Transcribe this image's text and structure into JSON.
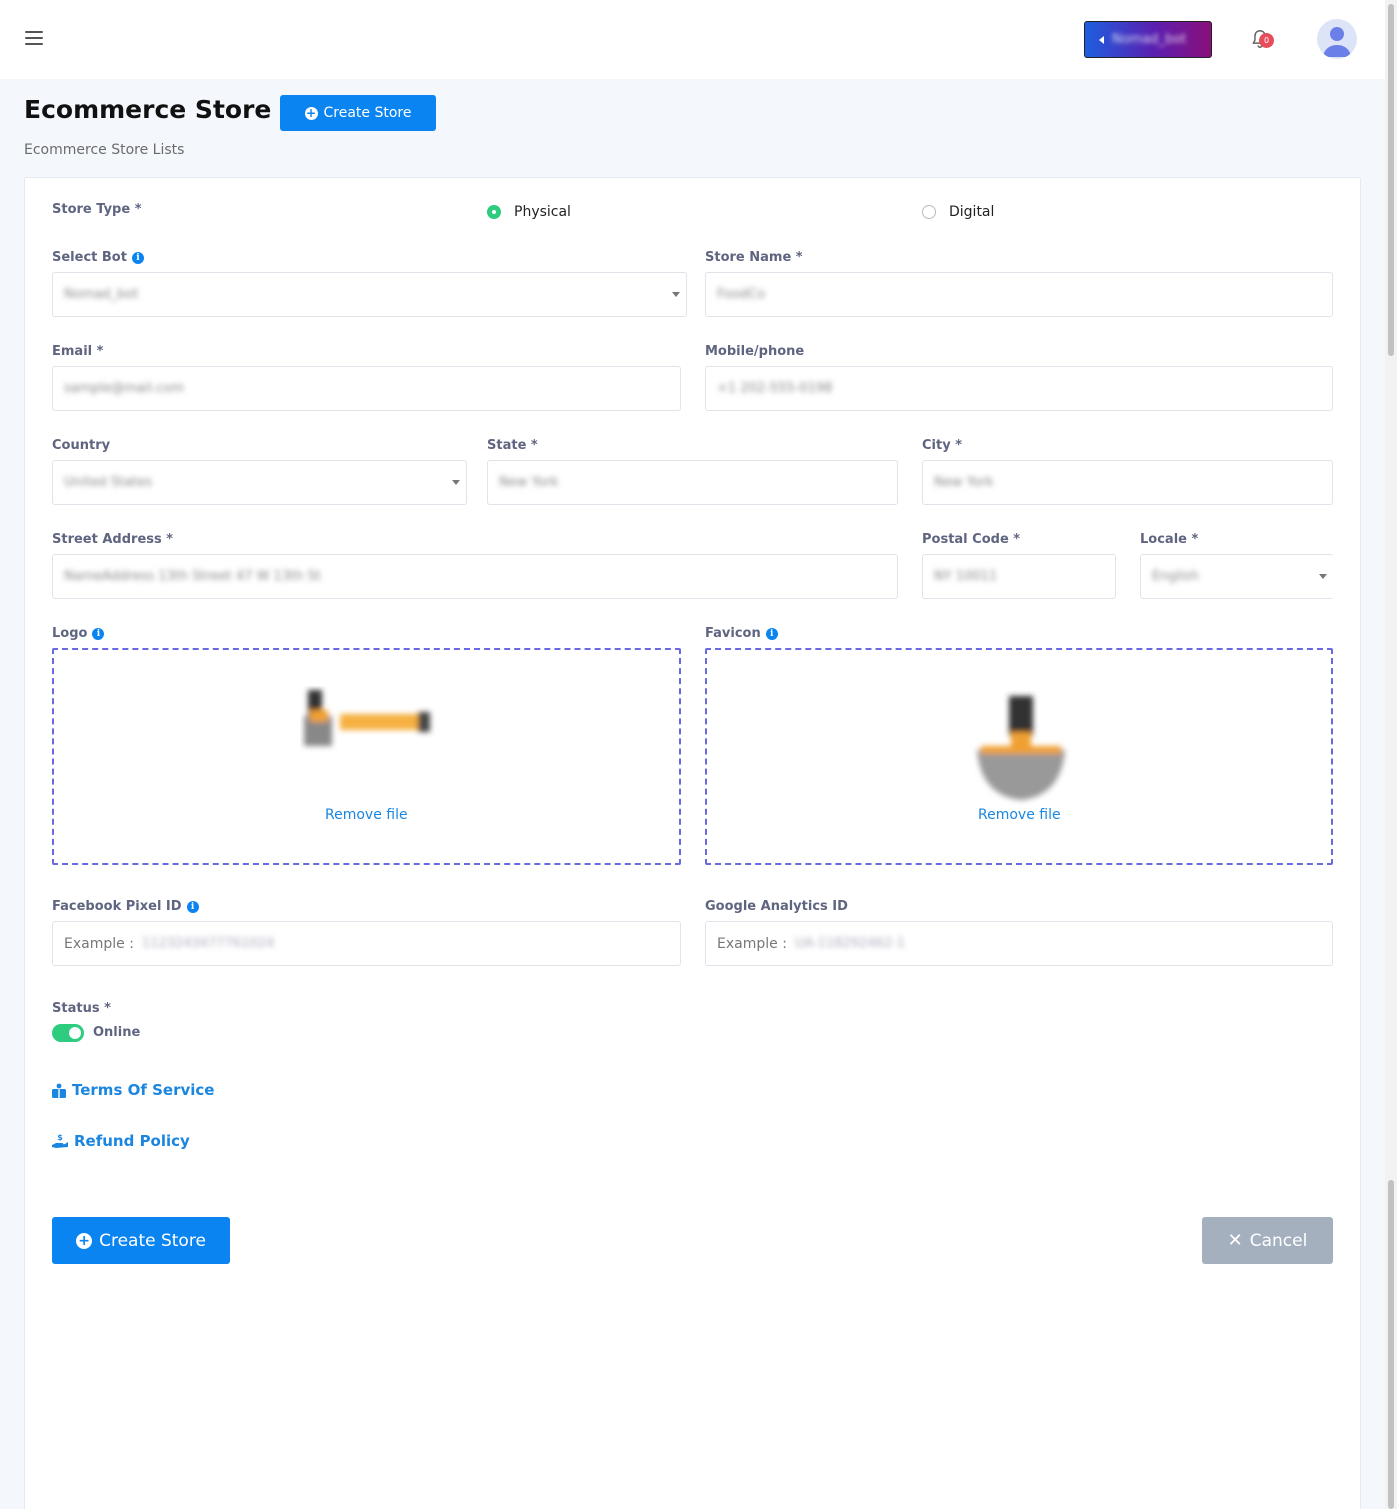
{
  "topbar": {
    "bot_switch_label": "Nomad_bot",
    "notification_count": "0"
  },
  "header": {
    "title": "Ecommerce Store",
    "create_button": "Create Store",
    "subtitle": "Ecommerce Store Lists"
  },
  "form": {
    "store_type": {
      "label": "Store Type *",
      "options": [
        "Physical",
        "Digital"
      ],
      "selected": "Physical"
    },
    "select_bot": {
      "label": "Select Bot",
      "value": "Nomad_bot"
    },
    "store_name": {
      "label": "Store Name *",
      "value": "FoodCo"
    },
    "email": {
      "label": "Email *",
      "value": "sample@mail.com"
    },
    "mobile": {
      "label": "Mobile/phone",
      "value": "+1 202-555-0198"
    },
    "country": {
      "label": "Country",
      "value": "United States"
    },
    "state": {
      "label": "State *",
      "value": "New York"
    },
    "city": {
      "label": "City *",
      "value": "New York"
    },
    "street": {
      "label": "Street Address *",
      "value": "NameAddress 13th Street 47 W 13th St"
    },
    "postal": {
      "label": "Postal Code *",
      "value": "NY 10011"
    },
    "locale": {
      "label": "Locale *",
      "value": "English"
    },
    "logo": {
      "label": "Logo",
      "remove": "Remove file"
    },
    "favicon": {
      "label": "Favicon",
      "remove": "Remove file"
    },
    "fb_pixel": {
      "label": "Facebook Pixel ID",
      "prefix": "Example :",
      "example": "1123243477761024"
    },
    "ga_id": {
      "label": "Google Analytics ID",
      "prefix": "Example :",
      "example": "UA-118292462-1"
    },
    "status": {
      "label": "Status *",
      "value": "Online"
    },
    "terms": "Terms Of Service",
    "refund": "Refund Policy",
    "submit": "Create Store",
    "cancel": "Cancel"
  },
  "colors": {
    "primary": "#0a84f0",
    "success": "#2ecc7f",
    "cancel": "#a5b0bf",
    "dropzone_border": "#6a6ae0"
  }
}
